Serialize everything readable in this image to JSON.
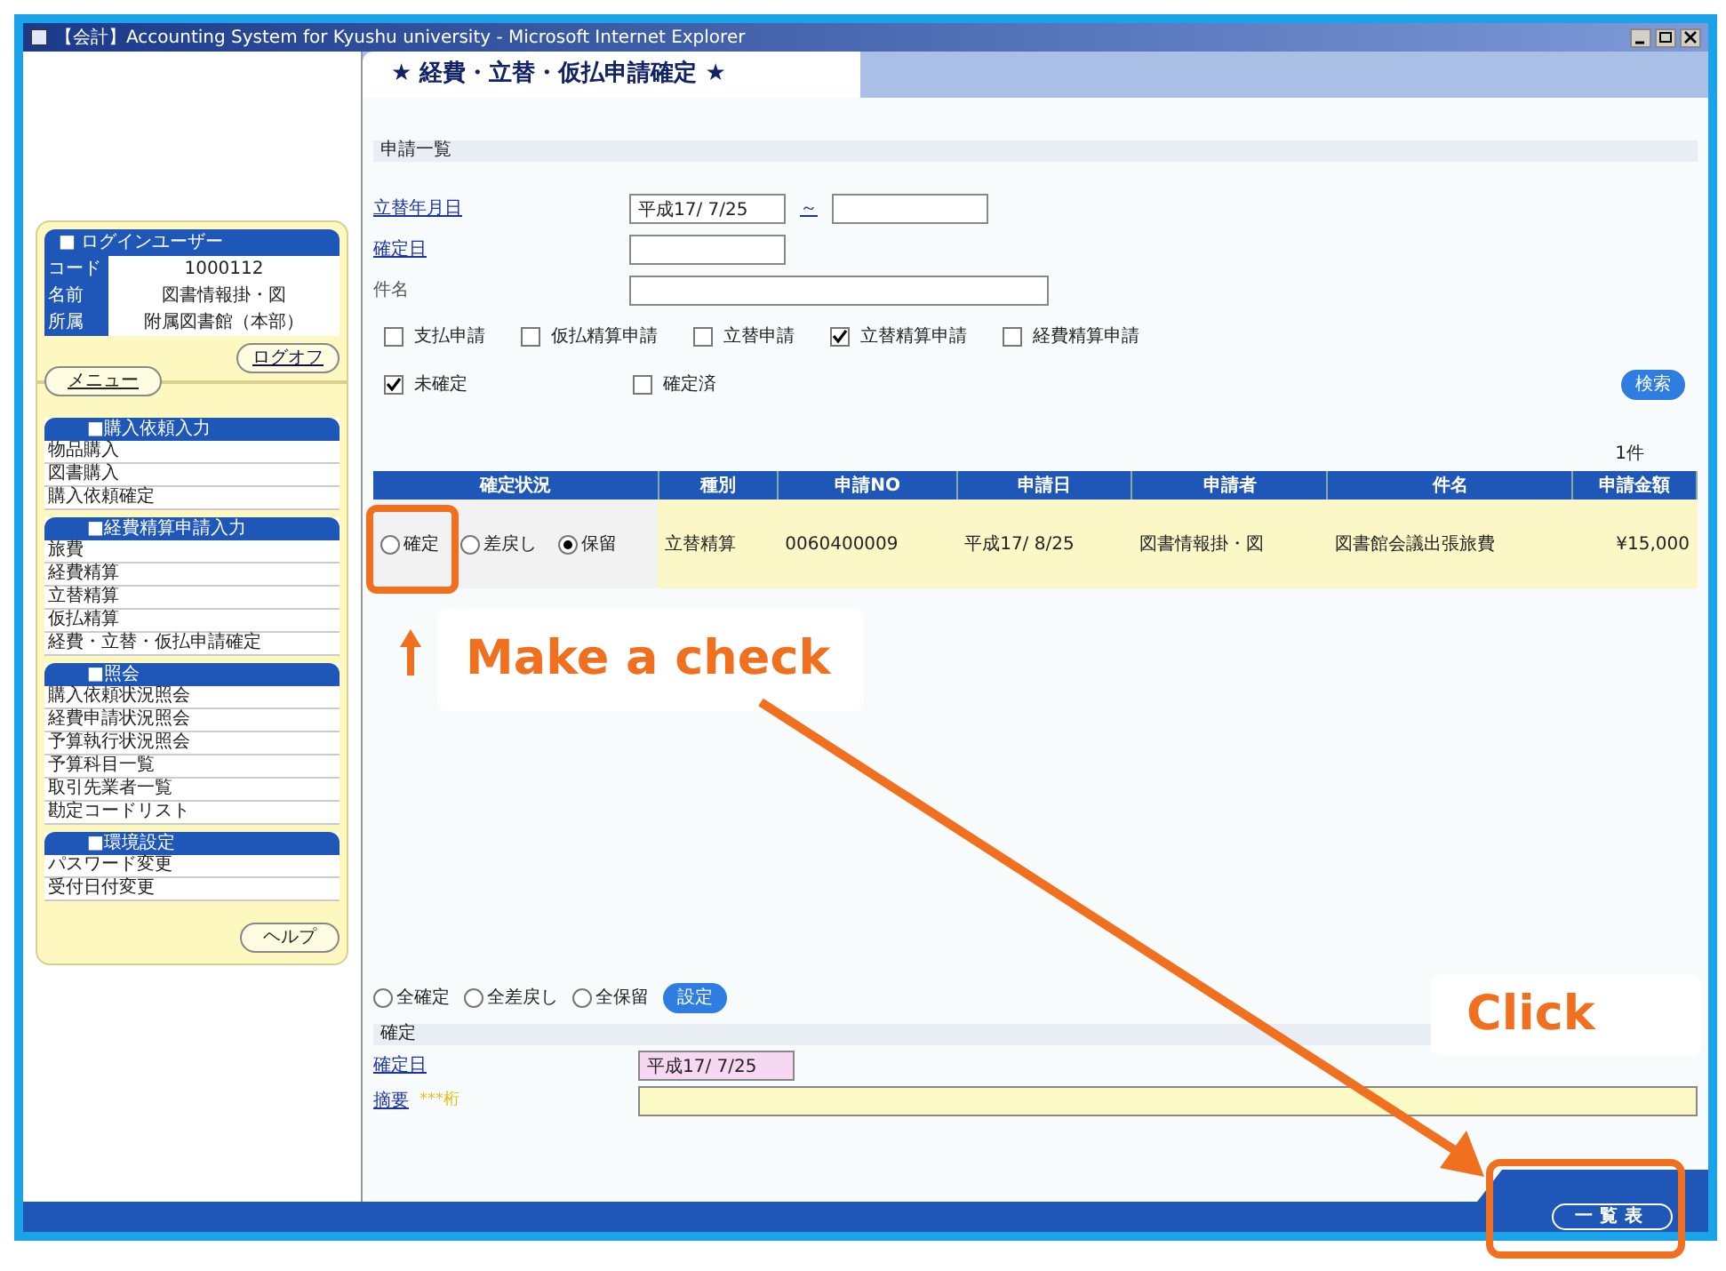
{
  "window": {
    "title": "【会計】Accounting System for Kyushu university - Microsoft Internet Explorer"
  },
  "sidebar": {
    "user": {
      "title": "■ ログインユーザー",
      "rows": [
        {
          "label": "コード",
          "value": "1000112"
        },
        {
          "label": "名前",
          "value": "図書情報掛・図"
        },
        {
          "label": "所属",
          "value": "附属図書館（本部）"
        }
      ]
    },
    "logoff_button": "ログオフ",
    "menu_button": "メニュー",
    "groups": [
      {
        "title": "■購入依頼入力",
        "items": [
          "物品購入",
          "図書購入",
          "購入依頼確定"
        ]
      },
      {
        "title": "■経費精算申請入力",
        "items": [
          "旅費",
          "経費精算",
          "立替精算",
          "仮払精算",
          "経費・立替・仮払申請確定"
        ]
      },
      {
        "title": "■照会",
        "items": [
          "購入依頼状況照会",
          "経費申請状況照会",
          "予算執行状況照会",
          "予算科目一覧",
          "取引先業者一覧",
          "勘定コードリスト"
        ]
      },
      {
        "title": "■環境設定",
        "items": [
          "パスワード変更",
          "受付日付変更"
        ]
      }
    ],
    "help_button": "ヘルプ"
  },
  "page_title": "★ 経費・立替・仮払申請確定 ★",
  "list_section": {
    "title": "申請一覧",
    "filters": [
      {
        "label": "立替年月日",
        "link": true,
        "value": "平成17/ 7/25",
        "separator": "～"
      },
      {
        "label": "確定日",
        "link": true
      },
      {
        "label": "件名",
        "link": false
      }
    ],
    "type_checks": [
      {
        "label": "支払申請",
        "checked": false
      },
      {
        "label": "仮払精算申請",
        "checked": false
      },
      {
        "label": "立替申請",
        "checked": false
      },
      {
        "label": "立替精算申請",
        "checked": true
      },
      {
        "label": "経費精算申請",
        "checked": false
      }
    ],
    "status_checks": [
      {
        "label": "未確定",
        "checked": true
      },
      {
        "label": "確定済",
        "checked": false
      }
    ],
    "search_button": "検索",
    "count": "1件"
  },
  "table": {
    "columns": [
      "確定状況",
      "種別",
      "申請NO",
      "申請日",
      "申請者",
      "件名",
      "申請金額"
    ],
    "rows": [
      {
        "cells": [
          {
            "options": [
              {
                "label": "確定",
                "selected": false
              },
              {
                "label": "差戻し",
                "selected": false
              },
              {
                "label": "保留",
                "selected": true
              }
            ]
          },
          "立替精算",
          "0060400009",
          "平成17/ 8/25",
          "図書情報掛・図",
          "図書館会議出張旅費",
          "¥15,000"
        ]
      }
    ]
  },
  "bulk_options": [
    {
      "label": "全確定",
      "selected": false
    },
    {
      "label": "全差戻し",
      "selected": false
    },
    {
      "label": "全保留",
      "selected": false
    }
  ],
  "set_button": "設定",
  "confirm_section": {
    "title": "確定",
    "fields": [
      {
        "label": "確定日",
        "value": "平成17/ 7/25",
        "kind": "date"
      },
      {
        "label": "摘要",
        "note": "***桁",
        "kind": "text"
      }
    ]
  },
  "footer_button": "一覧表",
  "annotations": [
    {
      "text": "Make a check",
      "kind": "check"
    },
    {
      "text": "Click",
      "kind": "click"
    }
  ]
}
